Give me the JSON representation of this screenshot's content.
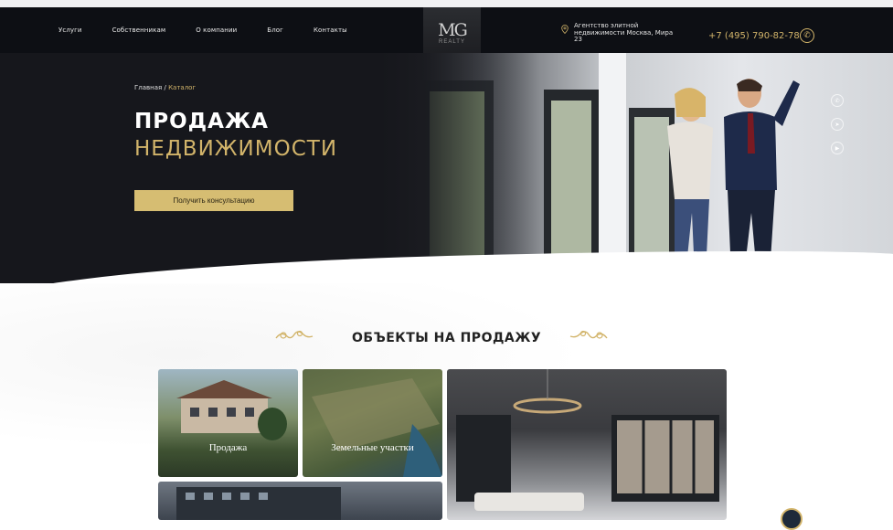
{
  "nav": [
    "Услуги",
    "Собственникам",
    "О компании",
    "Блог",
    "Контакты"
  ],
  "logo": {
    "mark": "MG",
    "sub": "REALTY"
  },
  "address": "Агентство элитной недвижимости Москва, Мира 23",
  "phone": "+7 (495) 790-82-78",
  "breadcrumb": {
    "home": "Главная",
    "separator": "/",
    "current": "Каталог"
  },
  "hero": {
    "line1": "ПРОДАЖА",
    "line2": "НЕДВИЖИМОСТИ",
    "cta": "Получить консультацию"
  },
  "section": {
    "title": "ОБЪЕКТЫ НА ПРОДАЖУ"
  },
  "cards": [
    {
      "label": "Продажа"
    },
    {
      "label": "Земельные участки"
    }
  ],
  "colors": {
    "accent": "#d2b46a",
    "header_bg": "#0d0f14",
    "hero_bg": "#16171c"
  }
}
